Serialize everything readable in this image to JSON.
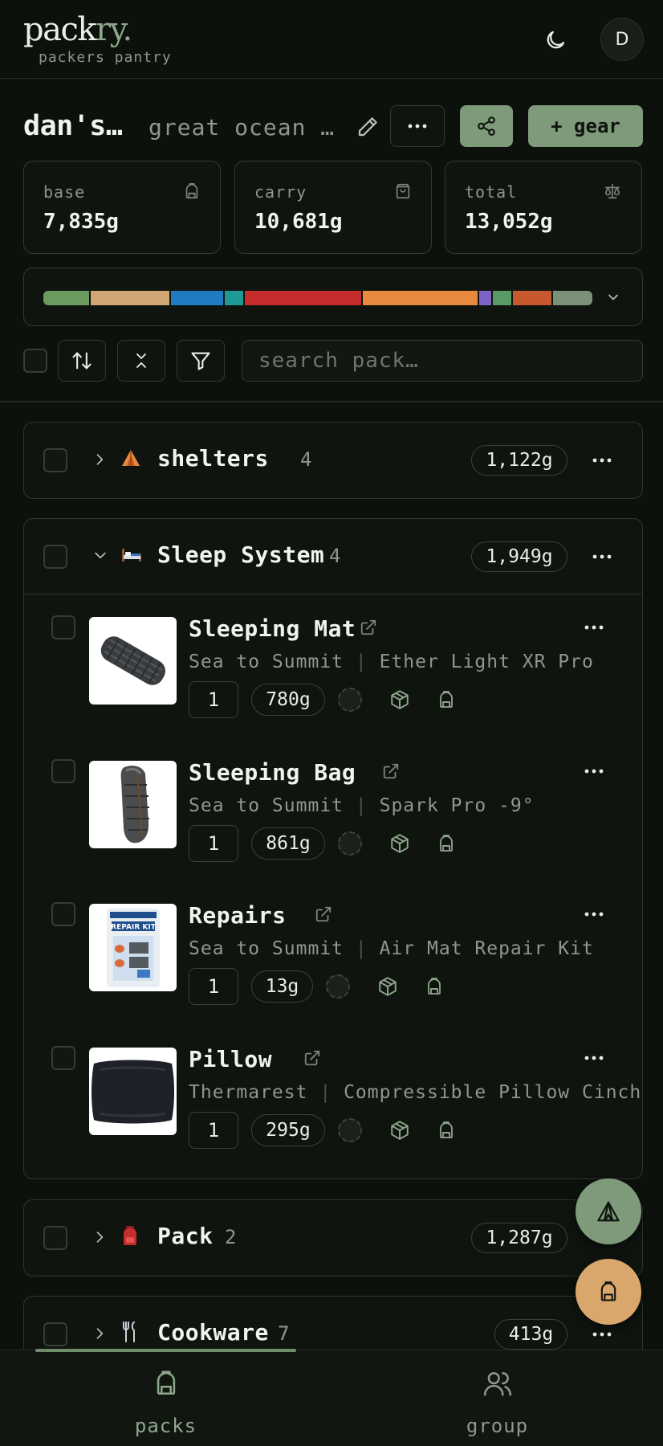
{
  "header": {
    "logo_main": "pack",
    "logo_accent": "ry.",
    "tagline": "packers pantry",
    "avatar_initial": "D"
  },
  "pack": {
    "title": "dan's…",
    "subtitle": "great ocean …",
    "gear_button": "+ gear"
  },
  "stats": [
    {
      "label": "base",
      "value": "7,835g",
      "icon": "backpack-icon"
    },
    {
      "label": "carry",
      "value": "10,681g",
      "icon": "bag-icon"
    },
    {
      "label": "total",
      "value": "13,052g",
      "icon": "scale-icon"
    }
  ],
  "category_bar": {
    "segments": [
      {
        "color": "#6a9a5e",
        "share": 0.085
      },
      {
        "color": "#d2a574",
        "share": 0.148
      },
      {
        "color": "#1f7cc0",
        "share": 0.098
      },
      {
        "color": "#1f9a96",
        "share": 0.034
      },
      {
        "color": "#c52c2c",
        "share": 0.218
      },
      {
        "color": "#e8893e",
        "share": 0.215
      },
      {
        "color": "#7f63c6",
        "share": 0.022
      },
      {
        "color": "#5a9a68",
        "share": 0.034
      },
      {
        "color": "#c8582e",
        "share": 0.073
      },
      {
        "color": "#7a9177",
        "share": 0.073
      }
    ]
  },
  "search": {
    "placeholder": "search pack…"
  },
  "categories": [
    {
      "emoji": "⛺",
      "name": "shelters",
      "count": "4",
      "weight": "1,122g",
      "expanded": false
    },
    {
      "emoji": "🛏",
      "name": "Sleep System",
      "count": "4",
      "weight": "1,949g",
      "expanded": true
    },
    {
      "emoji": "🎒",
      "name": "Pack",
      "count": "2",
      "weight": "1,287g",
      "expanded": false
    },
    {
      "emoji": "🍴",
      "name": "Cookware",
      "count": "7",
      "weight": "413g",
      "expanded": false
    }
  ],
  "items": [
    {
      "name": "Sleeping Mat",
      "brand": "Sea to Summit",
      "model": "Ether Light XR Pro",
      "qty": "1",
      "weight": "780g"
    },
    {
      "name": "Sleeping Bag",
      "brand": "Sea to Summit",
      "model": "Spark Pro -9°",
      "qty": "1",
      "weight": "861g"
    },
    {
      "name": "Repairs",
      "brand": "Sea to Summit",
      "model": "Air Mat Repair Kit",
      "qty": "1",
      "weight": "13g"
    },
    {
      "name": "Pillow",
      "brand": "Thermarest",
      "model": "Compressible Pillow Cinch",
      "qty": "1",
      "weight": "295g"
    }
  ],
  "bottom_nav": [
    {
      "label": "packs",
      "active": true,
      "color": "#8ea88a"
    },
    {
      "label": "group",
      "active": false,
      "color": "#8f988c"
    }
  ]
}
